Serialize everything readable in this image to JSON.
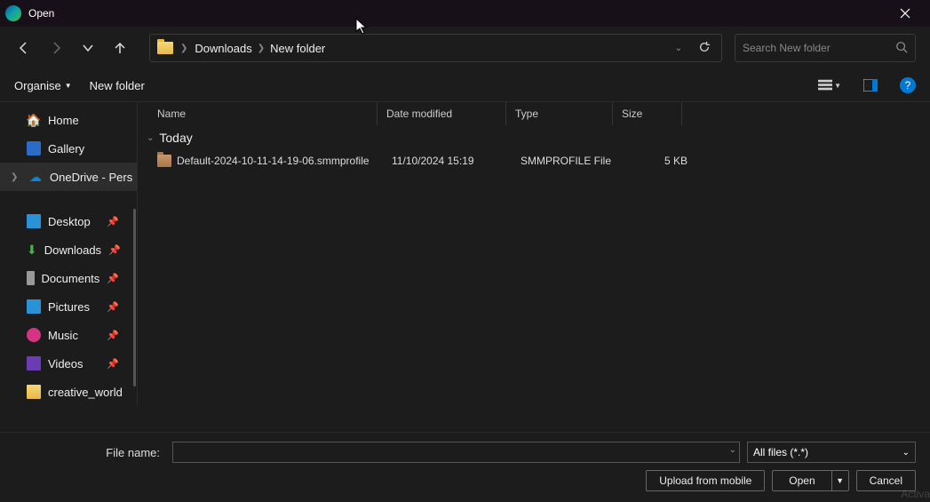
{
  "title": "Open",
  "breadcrumb": [
    "Downloads",
    "New folder"
  ],
  "search": {
    "placeholder": "Search New folder"
  },
  "cmdbar": {
    "organise": "Organise",
    "newfolder": "New folder"
  },
  "columns": {
    "name": "Name",
    "date": "Date modified",
    "type": "Type",
    "size": "Size"
  },
  "group": "Today",
  "files": [
    {
      "name": "Default-2024-10-11-14-19-06.smmprofile",
      "date": "11/10/2024 15:19",
      "type": "SMMPROFILE File",
      "size": "5 KB"
    }
  ],
  "sidebar": {
    "home": "Home",
    "gallery": "Gallery",
    "onedrive": "OneDrive - Pers",
    "desktop": "Desktop",
    "downloads": "Downloads",
    "documents": "Documents",
    "pictures": "Pictures",
    "music": "Music",
    "videos": "Videos",
    "creative": "creative_world"
  },
  "bottom": {
    "fn_label": "File name:",
    "filter": "All files (*.*)",
    "upload": "Upload from mobile",
    "open": "Open",
    "cancel": "Cancel"
  },
  "watermark": "Activa"
}
